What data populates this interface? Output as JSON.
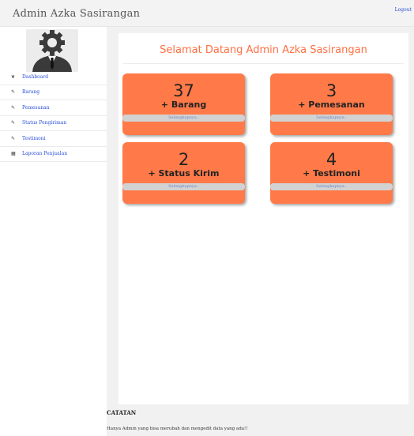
{
  "app": {
    "brand": "Admin Azka Sasirangan",
    "logout_label": "Logout"
  },
  "sidebar": {
    "items": [
      {
        "icon": "home-icon",
        "glyph": "❦",
        "label": "Dashboard"
      },
      {
        "icon": "edit-icon",
        "glyph": "✎",
        "label": "Barang"
      },
      {
        "icon": "edit-icon",
        "glyph": "✎",
        "label": "Pemesanan"
      },
      {
        "icon": "edit-icon",
        "glyph": "✎",
        "label": "Status Pengiriman"
      },
      {
        "icon": "edit-icon",
        "glyph": "✎",
        "label": "Testimoni"
      },
      {
        "icon": "report-icon",
        "glyph": "▦",
        "label": "Laporan Penjualan"
      }
    ]
  },
  "main": {
    "welcome": "Selamat Datang Admin Azka Sasirangan",
    "cards": [
      {
        "count": "37",
        "label": "+ Barang",
        "more": "Selengkapnya.."
      },
      {
        "count": "3",
        "label": "+ Pemesanan",
        "more": "Selengkapnya.."
      },
      {
        "count": "2",
        "label": "+ Status Kirim",
        "more": "Selengkapnya.."
      },
      {
        "count": "4",
        "label": "+ Testimoni",
        "more": "Selengkapnya.."
      }
    ],
    "note_title": "CATATAN",
    "note_text": "Hanya Admin yang bisa merubah dan mengedit data yang ada!!"
  },
  "colors": {
    "accent": "#ff6f43",
    "card": "#ff7a48",
    "link": "#2a4fd8"
  }
}
